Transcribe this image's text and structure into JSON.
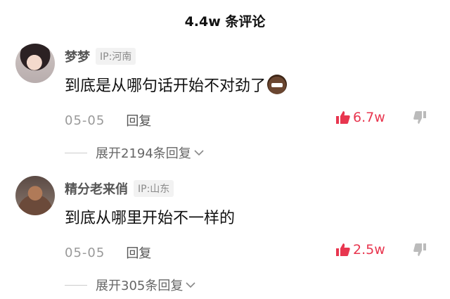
{
  "header": {
    "title": "4.4w 条评论"
  },
  "comments": [
    {
      "username": "梦梦",
      "ip": "IP:河南",
      "text": "到底是从哪句话开始不对劲了",
      "date": "05-05",
      "reply_label": "回复",
      "likes": "6.7w",
      "expand_label": "展开2194条回复",
      "emoji_icon": "mischievous-emoji-icon"
    },
    {
      "username": "精分老来俏",
      "ip": "IP:山东",
      "text": "到底从哪里开始不一样的",
      "date": "05-05",
      "reply_label": "回复",
      "likes": "2.5w",
      "expand_label": "展开305条回复"
    }
  ],
  "colors": {
    "like": "#e8364f",
    "muted": "#999999",
    "text": "#111111"
  }
}
